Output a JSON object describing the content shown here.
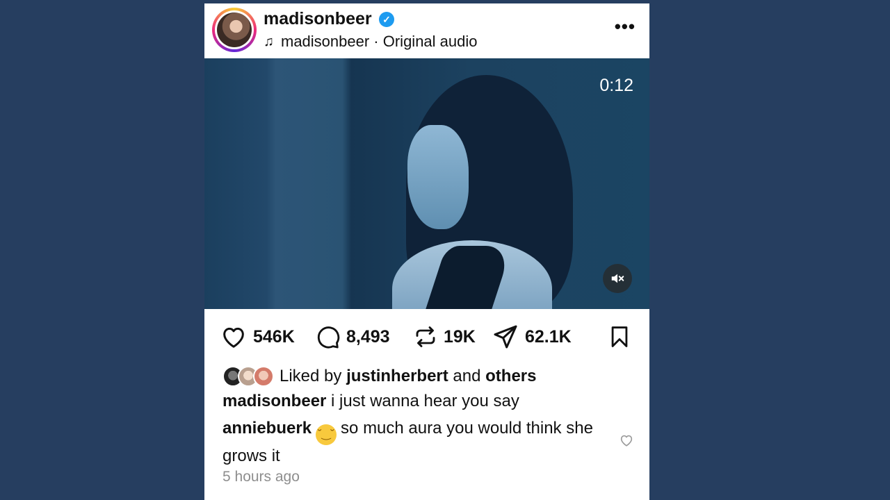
{
  "header": {
    "username": "madisonbeer",
    "verified_icon": "verified-badge-icon",
    "audio_owner": "madisonbeer",
    "audio_label": "madisonbeer · Original audio",
    "more_icon": "more-options-icon"
  },
  "media": {
    "timer": "0:12",
    "mute_icon": "muted-speaker-icon"
  },
  "actions": {
    "likes": "546K",
    "comments": "8,493",
    "reposts": "19K",
    "shares": "62.1K"
  },
  "liked_by": {
    "prefix": "Liked by ",
    "user": "justinherbert",
    "middle": " and ",
    "others": "others"
  },
  "caption": {
    "user": "madisonbeer",
    "text": " i just wanna hear you say"
  },
  "comment": {
    "user": "anniebuerk",
    "text": "so much aura you would think she grows it"
  },
  "timestamp": "5 hours ago",
  "colors": {
    "background": "#263e60",
    "verified": "#1d9bf0"
  }
}
